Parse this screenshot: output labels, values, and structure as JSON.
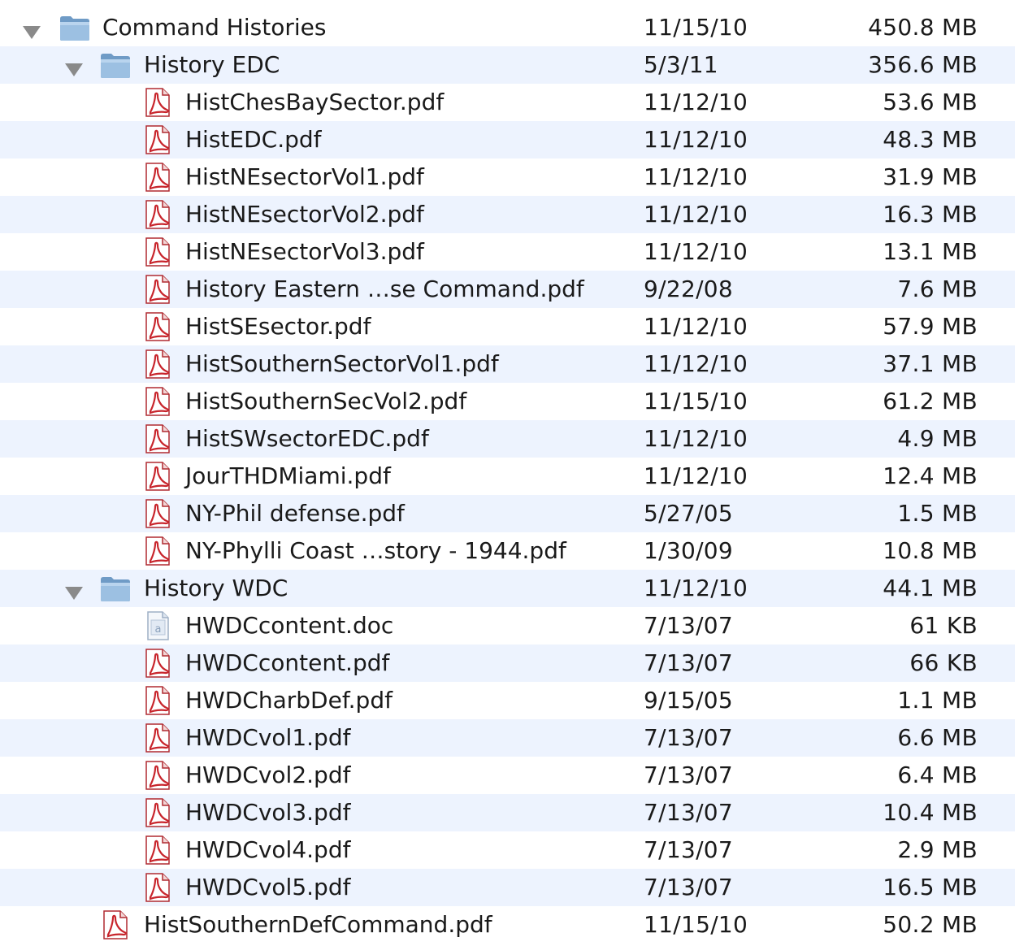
{
  "colors": {
    "stripe": "#edf3fe",
    "pdf_red": "#c8252c",
    "folder_blue": "#8fb4d8",
    "text": "#1a1a1a"
  },
  "rows": [
    {
      "name": "Command Histories",
      "date": "11/15/10",
      "size": "450.8 MB",
      "kind": "folder",
      "depth": 0,
      "expanded": true
    },
    {
      "name": "History EDC",
      "date": "5/3/11",
      "size": "356.6 MB",
      "kind": "folder",
      "depth": 1,
      "expanded": true
    },
    {
      "name": "HistChesBaySector.pdf",
      "date": "11/12/10",
      "size": "53.6 MB",
      "kind": "pdf",
      "depth": 2
    },
    {
      "name": "HistEDC.pdf",
      "date": "11/12/10",
      "size": "48.3 MB",
      "kind": "pdf",
      "depth": 2
    },
    {
      "name": "HistNEsectorVol1.pdf",
      "date": "11/12/10",
      "size": "31.9 MB",
      "kind": "pdf",
      "depth": 2
    },
    {
      "name": "HistNEsectorVol2.pdf",
      "date": "11/12/10",
      "size": "16.3 MB",
      "kind": "pdf",
      "depth": 2
    },
    {
      "name": "HistNEsectorVol3.pdf",
      "date": "11/12/10",
      "size": "13.1 MB",
      "kind": "pdf",
      "depth": 2
    },
    {
      "name": "History Eastern …se Command.pdf",
      "date": "9/22/08",
      "size": "7.6 MB",
      "kind": "pdf",
      "depth": 2
    },
    {
      "name": "HistSEsector.pdf",
      "date": "11/12/10",
      "size": "57.9 MB",
      "kind": "pdf",
      "depth": 2
    },
    {
      "name": "HistSouthernSectorVol1.pdf",
      "date": "11/12/10",
      "size": "37.1 MB",
      "kind": "pdf",
      "depth": 2
    },
    {
      "name": "HistSouthernSecVol2.pdf",
      "date": "11/15/10",
      "size": "61.2 MB",
      "kind": "pdf",
      "depth": 2
    },
    {
      "name": "HistSWsectorEDC.pdf",
      "date": "11/12/10",
      "size": "4.9 MB",
      "kind": "pdf",
      "depth": 2
    },
    {
      "name": "JourTHDMiami.pdf",
      "date": "11/12/10",
      "size": "12.4 MB",
      "kind": "pdf",
      "depth": 2
    },
    {
      "name": "NY-Phil defense.pdf",
      "date": "5/27/05",
      "size": "1.5 MB",
      "kind": "pdf",
      "depth": 2
    },
    {
      "name": "NY-Phylli Coast …story - 1944.pdf",
      "date": "1/30/09",
      "size": "10.8 MB",
      "kind": "pdf",
      "depth": 2
    },
    {
      "name": "History WDC",
      "date": "11/12/10",
      "size": "44.1 MB",
      "kind": "folder",
      "depth": 1,
      "expanded": true
    },
    {
      "name": "HWDCcontent.doc",
      "date": "7/13/07",
      "size": "61 KB",
      "kind": "doc",
      "depth": 2
    },
    {
      "name": "HWDCcontent.pdf",
      "date": "7/13/07",
      "size": "66 KB",
      "kind": "pdf",
      "depth": 2
    },
    {
      "name": "HWDCharbDef.pdf",
      "date": "9/15/05",
      "size": "1.1 MB",
      "kind": "pdf",
      "depth": 2
    },
    {
      "name": "HWDCvol1.pdf",
      "date": "7/13/07",
      "size": "6.6 MB",
      "kind": "pdf",
      "depth": 2
    },
    {
      "name": "HWDCvol2.pdf",
      "date": "7/13/07",
      "size": "6.4 MB",
      "kind": "pdf",
      "depth": 2
    },
    {
      "name": "HWDCvol3.pdf",
      "date": "7/13/07",
      "size": "10.4 MB",
      "kind": "pdf",
      "depth": 2
    },
    {
      "name": "HWDCvol4.pdf",
      "date": "7/13/07",
      "size": "2.9 MB",
      "kind": "pdf",
      "depth": 2
    },
    {
      "name": "HWDCvol5.pdf",
      "date": "7/13/07",
      "size": "16.5 MB",
      "kind": "pdf",
      "depth": 2
    },
    {
      "name": "HistSouthernDefCommand.pdf",
      "date": "11/15/10",
      "size": "50.2 MB",
      "kind": "pdf",
      "depth": 1
    }
  ]
}
